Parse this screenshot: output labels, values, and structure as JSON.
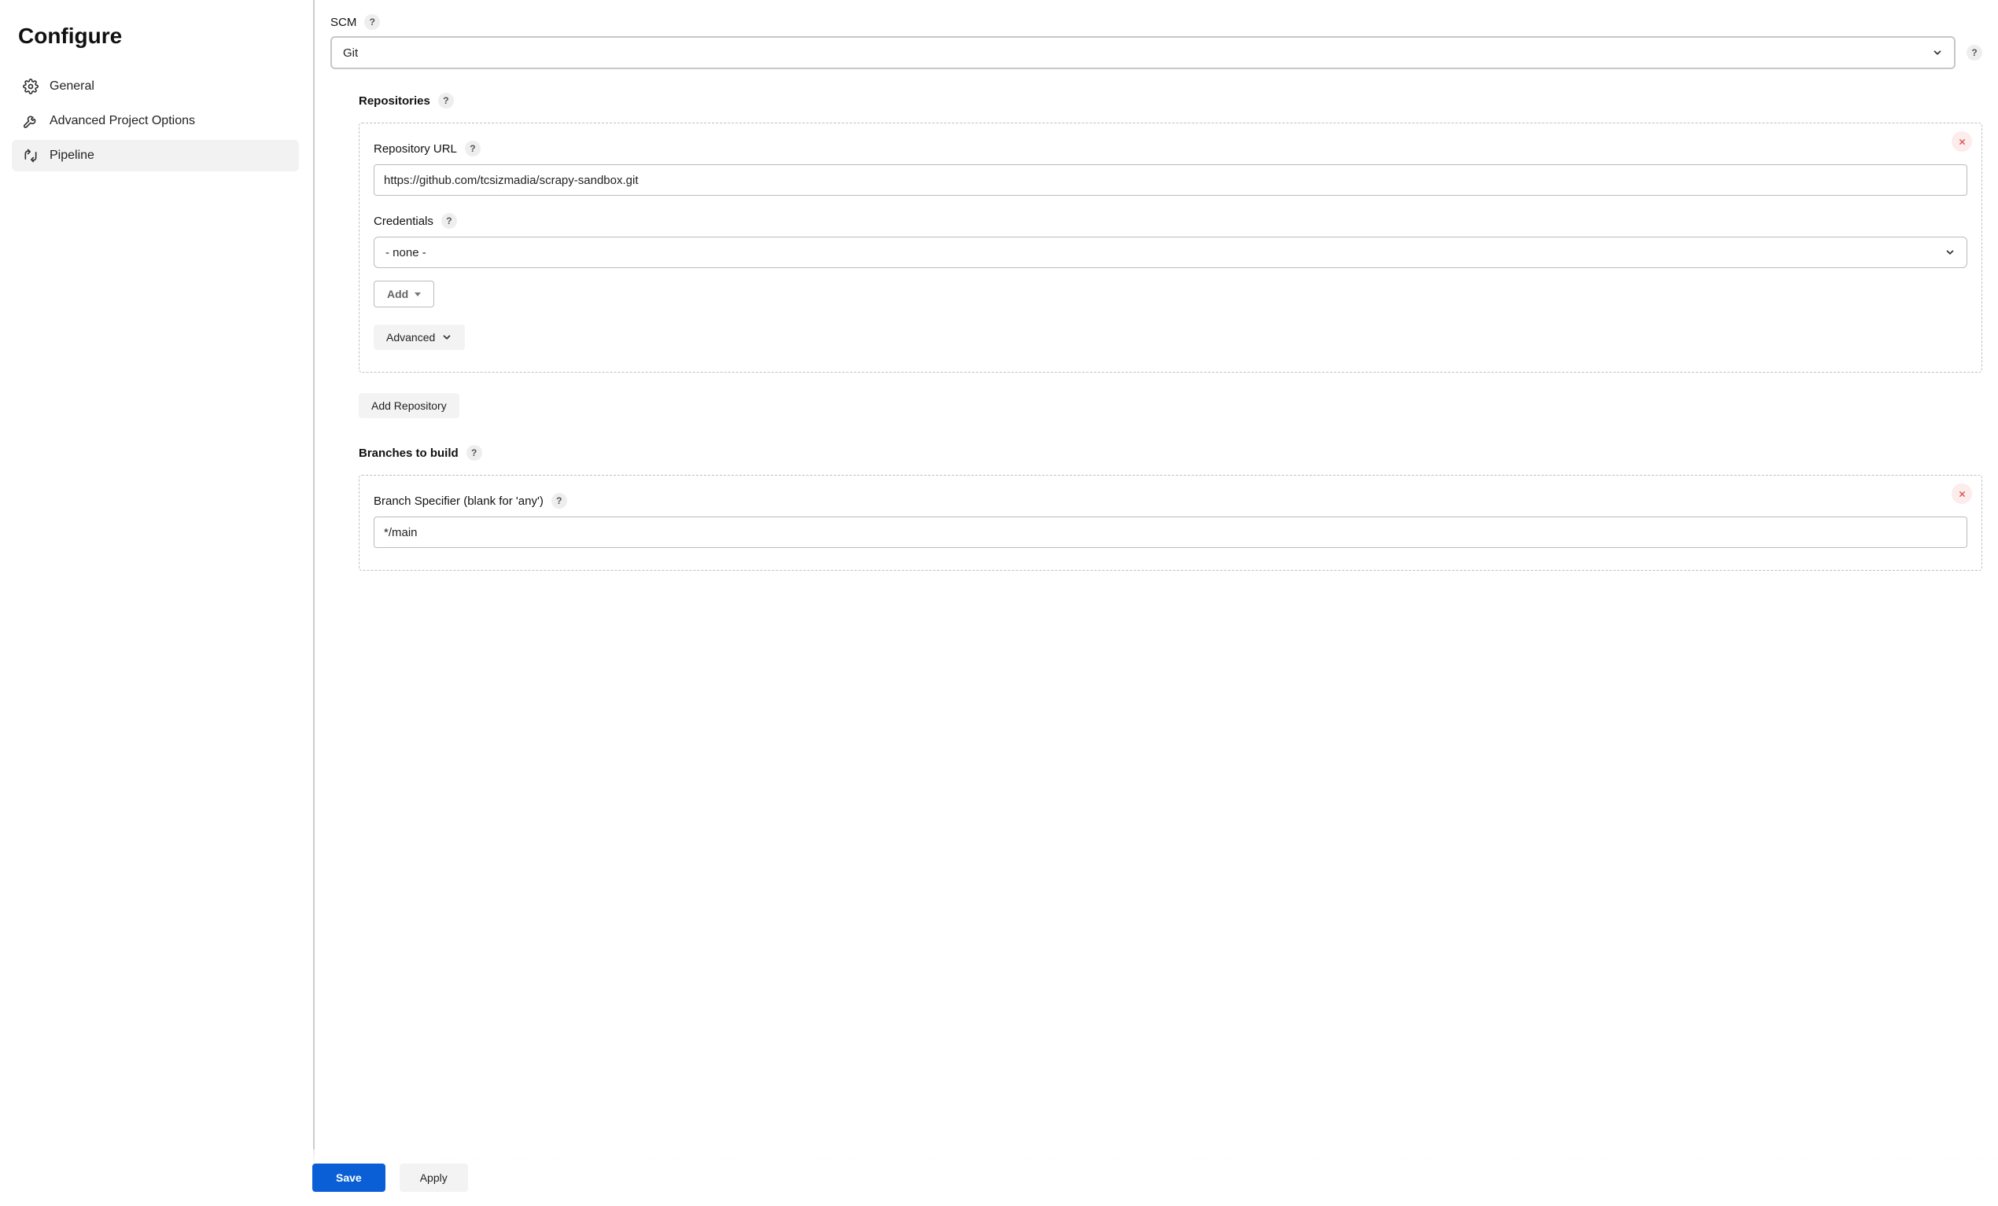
{
  "sidebar": {
    "title": "Configure",
    "items": [
      {
        "label": "General"
      },
      {
        "label": "Advanced Project Options"
      },
      {
        "label": "Pipeline"
      }
    ]
  },
  "scm": {
    "label": "SCM",
    "selected": "Git"
  },
  "repositories": {
    "title": "Repositories",
    "repo_url_label": "Repository URL",
    "repo_url_value": "https://github.com/tcsizmadia/scrapy-sandbox.git",
    "credentials_label": "Credentials",
    "credentials_value": "- none -",
    "add_btn": "Add",
    "advanced_btn": "Advanced",
    "add_repo_btn": "Add Repository"
  },
  "branches": {
    "title": "Branches to build",
    "specifier_label": "Branch Specifier (blank for 'any')",
    "specifier_value": "*/main"
  },
  "footer": {
    "save": "Save",
    "apply": "Apply"
  }
}
